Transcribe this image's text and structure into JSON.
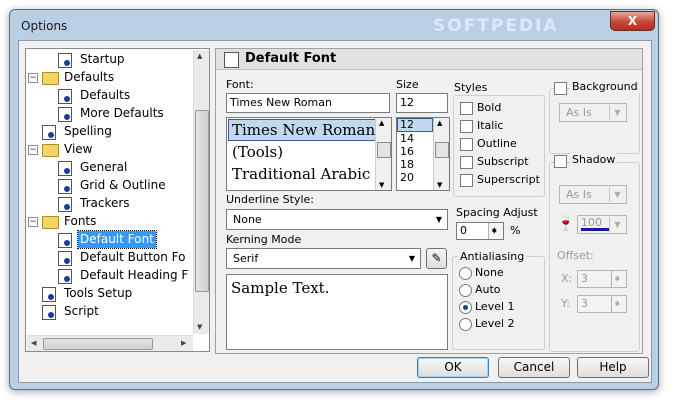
{
  "window": {
    "title": "Options",
    "watermark": "SOFTPEDIA",
    "close_glyph": "X"
  },
  "tree": {
    "items": [
      {
        "label": "Startup",
        "level": 1,
        "icon": "page-icon"
      },
      {
        "label": "Defaults",
        "level": 0,
        "icon": "folder-icon",
        "expanded": true
      },
      {
        "label": "Defaults",
        "level": 1,
        "icon": "page-icon"
      },
      {
        "label": "More Defaults",
        "level": 1,
        "icon": "page-icon"
      },
      {
        "label": "Spelling",
        "level": 0,
        "icon": "page-icon"
      },
      {
        "label": "View",
        "level": 0,
        "icon": "folder-icon",
        "expanded": true
      },
      {
        "label": "General",
        "level": 1,
        "icon": "page-icon"
      },
      {
        "label": "Grid & Outline",
        "level": 1,
        "icon": "page-icon"
      },
      {
        "label": "Trackers",
        "level": 1,
        "icon": "page-icon"
      },
      {
        "label": "Fonts",
        "level": 0,
        "icon": "folder-icon",
        "expanded": true
      },
      {
        "label": "Default Font",
        "level": 1,
        "icon": "page-icon",
        "selected": true
      },
      {
        "label": "Default Button Fo",
        "level": 1,
        "icon": "page-icon"
      },
      {
        "label": "Default Heading F",
        "level": 1,
        "icon": "page-icon"
      },
      {
        "label": "Tools Setup",
        "level": 0,
        "icon": "page-icon"
      },
      {
        "label": "Script",
        "level": 0,
        "icon": "page-icon"
      }
    ]
  },
  "panel": {
    "title": "Default Font",
    "font_label": "Font:",
    "font_value": "Times New Roman",
    "font_list": [
      "Times New Roman",
      "(Tools)",
      "Traditional Arabic"
    ],
    "size_label": "Size",
    "size_value": "12",
    "size_list": [
      "12",
      "14",
      "16",
      "18",
      "20"
    ],
    "styles_label": "Styles",
    "styles": [
      {
        "label": "Bold",
        "checked": false
      },
      {
        "label": "Italic",
        "checked": false
      },
      {
        "label": "Outline",
        "checked": false
      },
      {
        "label": "Subscript",
        "checked": false
      },
      {
        "label": "Superscript",
        "checked": false
      }
    ],
    "underline_label": "Underline Style:",
    "underline_value": "None",
    "kerning_label": "Kerning Mode",
    "kerning_value": "Serif",
    "spacing_label": "Spacing Adjust",
    "spacing_value": "0",
    "spacing_unit": "%",
    "antialias_label": "Antialiasing",
    "antialias_options": [
      {
        "label": "None",
        "selected": false
      },
      {
        "label": "Auto",
        "selected": false
      },
      {
        "label": "Level 1",
        "selected": true
      },
      {
        "label": "Level 2",
        "selected": false
      }
    ],
    "sample_text": "Sample Text.",
    "background_label": "Background",
    "background_value": "As Is",
    "shadow_label": "Shadow",
    "shadow_value": "As Is",
    "shadow_opacity": "100",
    "offset_label": "Offset:",
    "offset_x_label": "X:",
    "offset_x_value": "3",
    "offset_y_label": "Y:",
    "offset_y_value": "3"
  },
  "buttons": {
    "ok": "OK",
    "cancel": "Cancel",
    "help": "Help"
  },
  "colors": {
    "selection": "#3399ff",
    "shadow_color": "#1a1aa0"
  }
}
